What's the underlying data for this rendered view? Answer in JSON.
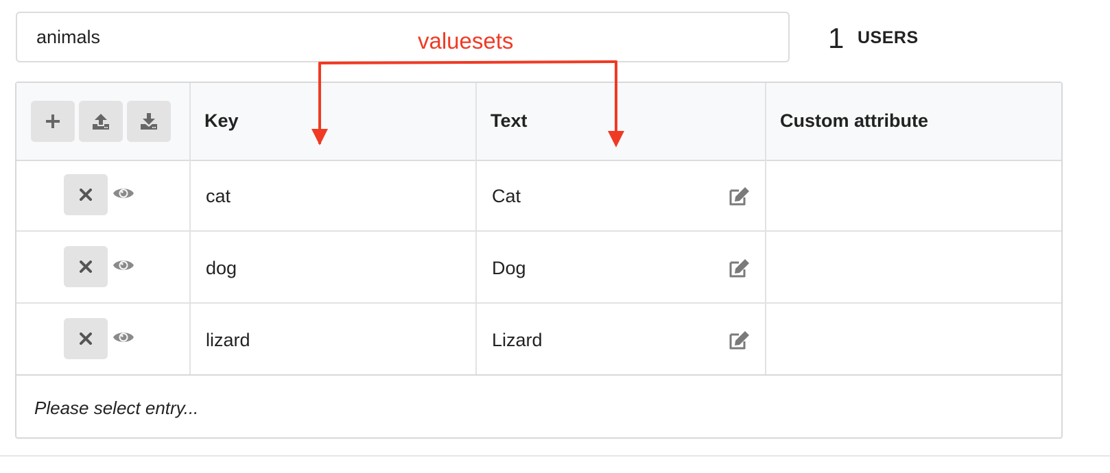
{
  "name_field": {
    "value": "animals"
  },
  "users": {
    "count": "1",
    "label": "USERS"
  },
  "annotation": {
    "label": "valuesets",
    "color": "#f03a24"
  },
  "toolbar": {
    "buttons": [
      {
        "icon": "plus-icon"
      },
      {
        "icon": "upload-icon"
      },
      {
        "icon": "download-icon"
      }
    ]
  },
  "table": {
    "columns": [
      "Key",
      "Text",
      "Custom attribute"
    ],
    "rows": [
      {
        "key": "cat",
        "text": "Cat",
        "custom": ""
      },
      {
        "key": "dog",
        "text": "Dog",
        "custom": ""
      },
      {
        "key": "lizard",
        "text": "Lizard",
        "custom": ""
      }
    ],
    "row_icons": [
      "close-icon",
      "eye-icon",
      "edit-icon"
    ]
  },
  "footer": {
    "placeholder": "Please select entry..."
  },
  "colors": {
    "button_bg": "#e3e3e3",
    "icon": "#666666",
    "header_bg": "#f8f9fa",
    "annotation": "#f03a24"
  }
}
